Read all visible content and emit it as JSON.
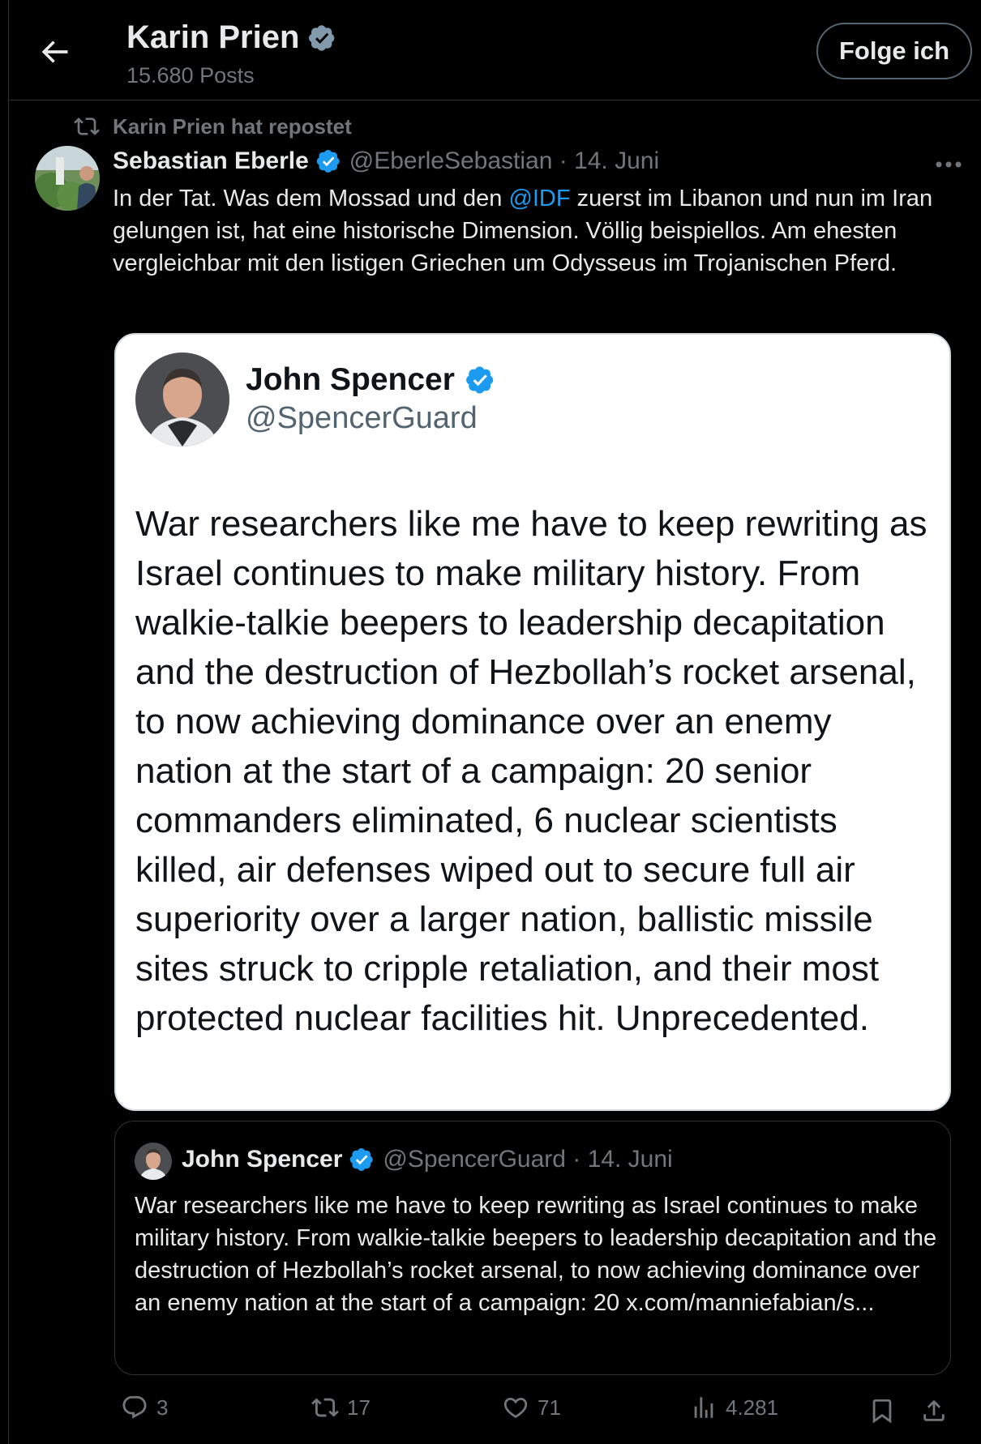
{
  "header": {
    "name": "Karin Prien",
    "posts_count": "15.680 Posts",
    "follow_label": "Folge ich"
  },
  "repost_label": "Karin Prien hat repostet",
  "post": {
    "author_name": "Sebastian Eberle",
    "author_meta": "@EberleSebastian · 14. Juni",
    "text_part1": "In der Tat. Was dem Mossad und den ",
    "mention": "@IDF",
    "text_part2": " zuerst im Libanon und nun im Iran gelungen ist, hat eine historische Dimension. Völlig beispiellos. Am ehesten vergleichbar mit den listigen Griechen um Odysseus im Trojanischen Pferd."
  },
  "card": {
    "name": "John Spencer",
    "handle": "@SpencerGuard",
    "text": "War researchers like me have to keep rewriting as Israel continues to make military history. From walkie-talkie beepers to leadership decapitation and the destruction of Hezbollah’s rocket arsenal, to now achieving dominance over an enemy nation at the start of a campaign: 20 senior commanders eliminated, 6 nuclear scientists killed, air defenses wiped out to secure full air superiority over a larger nation, ballistic missile sites struck to cripple retaliation, and their most protected nuclear facilities hit. Unprecedented."
  },
  "quote": {
    "name": "John Spencer",
    "meta": "@SpencerGuard · 14. Juni",
    "text": "War researchers like me have to keep rewriting as Israel continues to make military history. From walkie-talkie beepers to leadership decapitation and the destruction of Hezbollah’s rocket arsenal, to now achieving dominance over an enemy nation at the start of a campaign: 20 x.com/manniefabian/s..."
  },
  "actions": {
    "replies": "3",
    "reposts": "17",
    "likes": "71",
    "views": "4.281"
  },
  "colors": {
    "background": "#000000",
    "accent": "#1d9bf0",
    "muted": "#71767b",
    "border": "#2f3336"
  },
  "icons": [
    "back-arrow-icon",
    "verified-badge-icon",
    "repost-icon",
    "more-icon",
    "reply-icon",
    "like-icon",
    "views-icon",
    "bookmark-icon",
    "share-icon"
  ]
}
